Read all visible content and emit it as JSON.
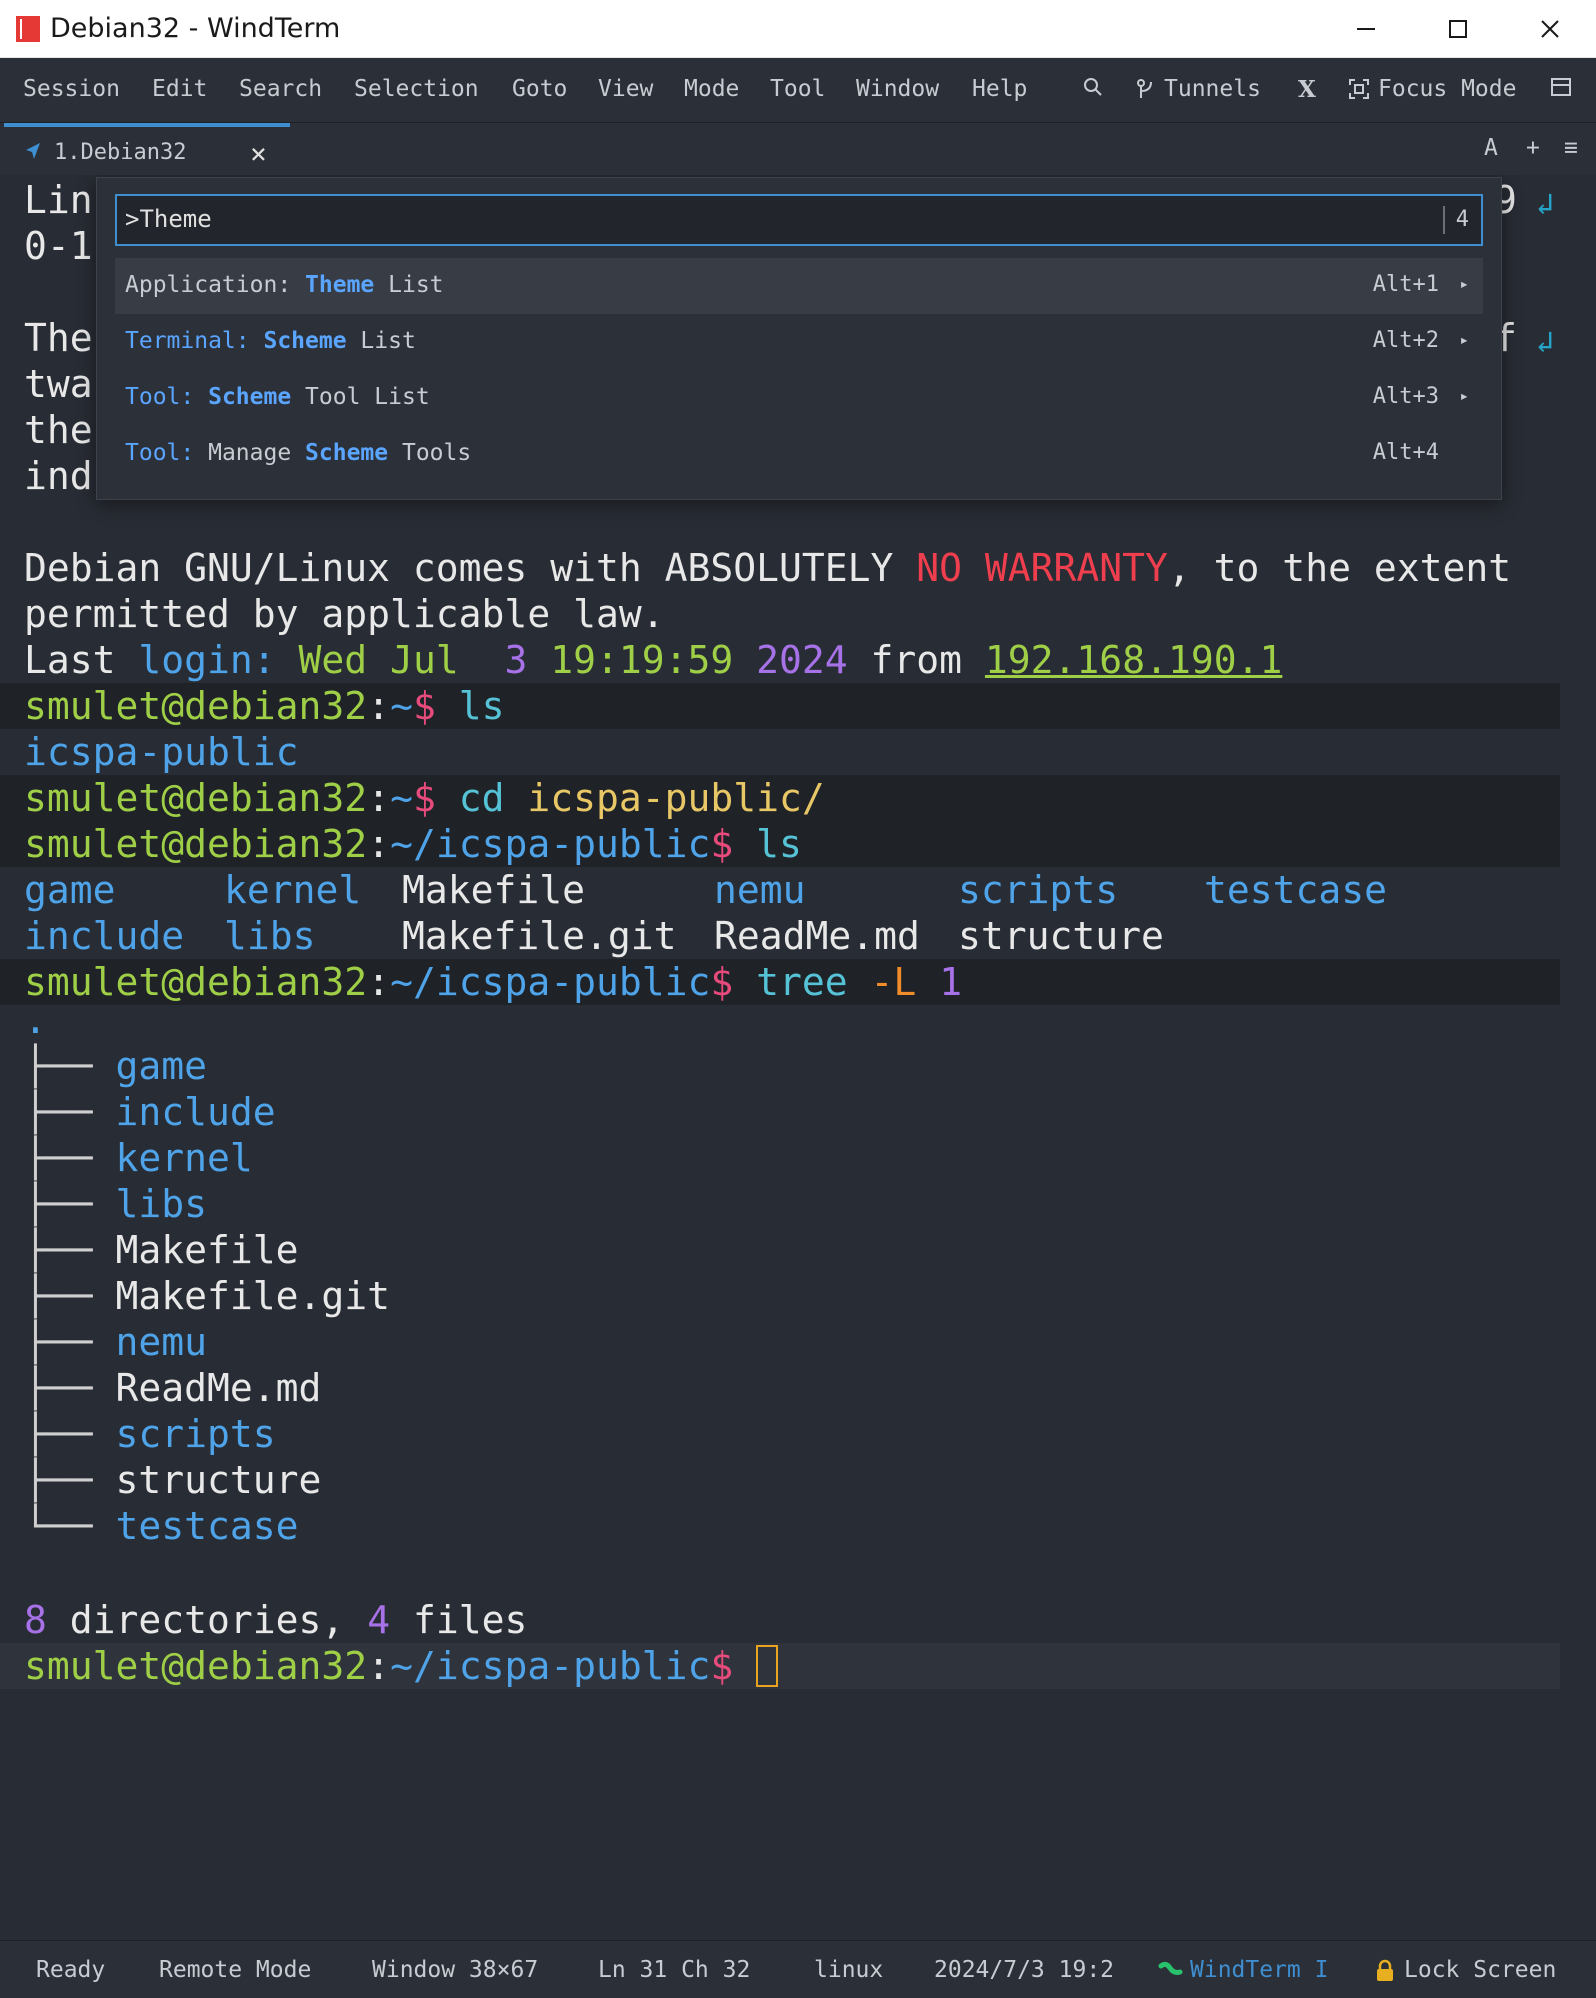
{
  "window": {
    "title": "Debian32 - WindTerm"
  },
  "menu": {
    "items": [
      "Session",
      "Edit",
      "Search",
      "Selection",
      "Goto",
      "View",
      "Mode",
      "Tool",
      "Window",
      "Help"
    ],
    "tunnels": "Tunnels",
    "x_label": "X",
    "focus_mode": "Focus Mode"
  },
  "tab": {
    "label": "1.Debian32",
    "close": "×",
    "tools": {
      "font": "A",
      "add": "+",
      "menu": "≡"
    }
  },
  "palette": {
    "query": ">Theme",
    "count": "4",
    "rows": [
      {
        "category": "Application:",
        "kw": "Theme",
        "rest": " List",
        "shortcut": "Alt+1",
        "arrow": "▸",
        "category_highlight": false
      },
      {
        "category": "Terminal:",
        "kw": "Scheme",
        "rest": " List",
        "shortcut": "Alt+2",
        "arrow": "▸",
        "category_highlight": true
      },
      {
        "category": "Tool:",
        "kw": "Scheme",
        "rest": " Tool List",
        "shortcut": "Alt+3",
        "arrow": "▸",
        "category_highlight": true
      },
      {
        "category": "Tool:",
        "pre": "Manage ",
        "kw": "Scheme",
        "rest": " Tools",
        "shortcut": "Alt+4",
        "arrow": "",
        "category_highlight": true
      }
    ]
  },
  "terminal": {
    "partial": {
      "l1": "Lin",
      "l2": "0-1",
      "l3": "The",
      "l4": "twa",
      "l5": "the",
      "l6": "ind",
      "r1": "9",
      "r3": "f"
    },
    "warranty_1": "Debian GNU/Linux comes with ABSOLUTELY ",
    "warranty_red": "NO WARRANTY",
    "warranty_2": ", to the extent",
    "warranty_3": "permitted by applicable law.",
    "last_login": {
      "prefix": "Last ",
      "login": "login:",
      "day": " Wed Jul  ",
      "date": "3",
      "time": " 19:19:59",
      "year": " 2024",
      "from": " from ",
      "ip": "192.168.190.1"
    },
    "prompt_user": "smulet@debian32",
    "prompt_home": "~",
    "prompt_dir": "~/icspa-public",
    "prompt_dollar": "$",
    "cmd_ls": "ls",
    "out_ls": "icspa-public",
    "cmd_cd": "cd",
    "cmd_cd_arg": "icspa-public/",
    "ls_grid": {
      "row1": [
        "game",
        "kernel",
        "Makefile",
        "nemu",
        "scripts",
        "testcase"
      ],
      "row2": [
        "include",
        "libs",
        "Makefile.git",
        "ReadMe.md",
        "structure"
      ]
    },
    "cmd_tree": "tree",
    "cmd_tree_flag": "-L",
    "cmd_tree_num": "1",
    "tree_root": ".",
    "tree_branch": "├── ",
    "tree_last": "└── ",
    "tree_items": [
      {
        "name": "game",
        "dir": true
      },
      {
        "name": "include",
        "dir": true
      },
      {
        "name": "kernel",
        "dir": true
      },
      {
        "name": "libs",
        "dir": true
      },
      {
        "name": "Makefile",
        "dir": false
      },
      {
        "name": "Makefile.git",
        "dir": false
      },
      {
        "name": "nemu",
        "dir": true
      },
      {
        "name": "ReadMe.md",
        "dir": false
      },
      {
        "name": "scripts",
        "dir": true
      },
      {
        "name": "structure",
        "dir": false
      },
      {
        "name": "testcase",
        "dir": true
      }
    ],
    "summary_dirs": "8",
    "summary_dirs_label": " directories, ",
    "summary_files": "4",
    "summary_files_label": " files"
  },
  "status": {
    "ready": "Ready",
    "mode": "Remote Mode",
    "window": "Window 38×67",
    "pos": "Ln 31 Ch 32",
    "os": "linux",
    "datetime": "2024/7/3 19:2",
    "app": "WindTerm I",
    "lock": "Lock Screen"
  },
  "colors": {
    "accent": "#3e8ed0",
    "prompt": "#9fcf47",
    "dir": "#4fa3e8",
    "warning": "#ef3f4f"
  }
}
